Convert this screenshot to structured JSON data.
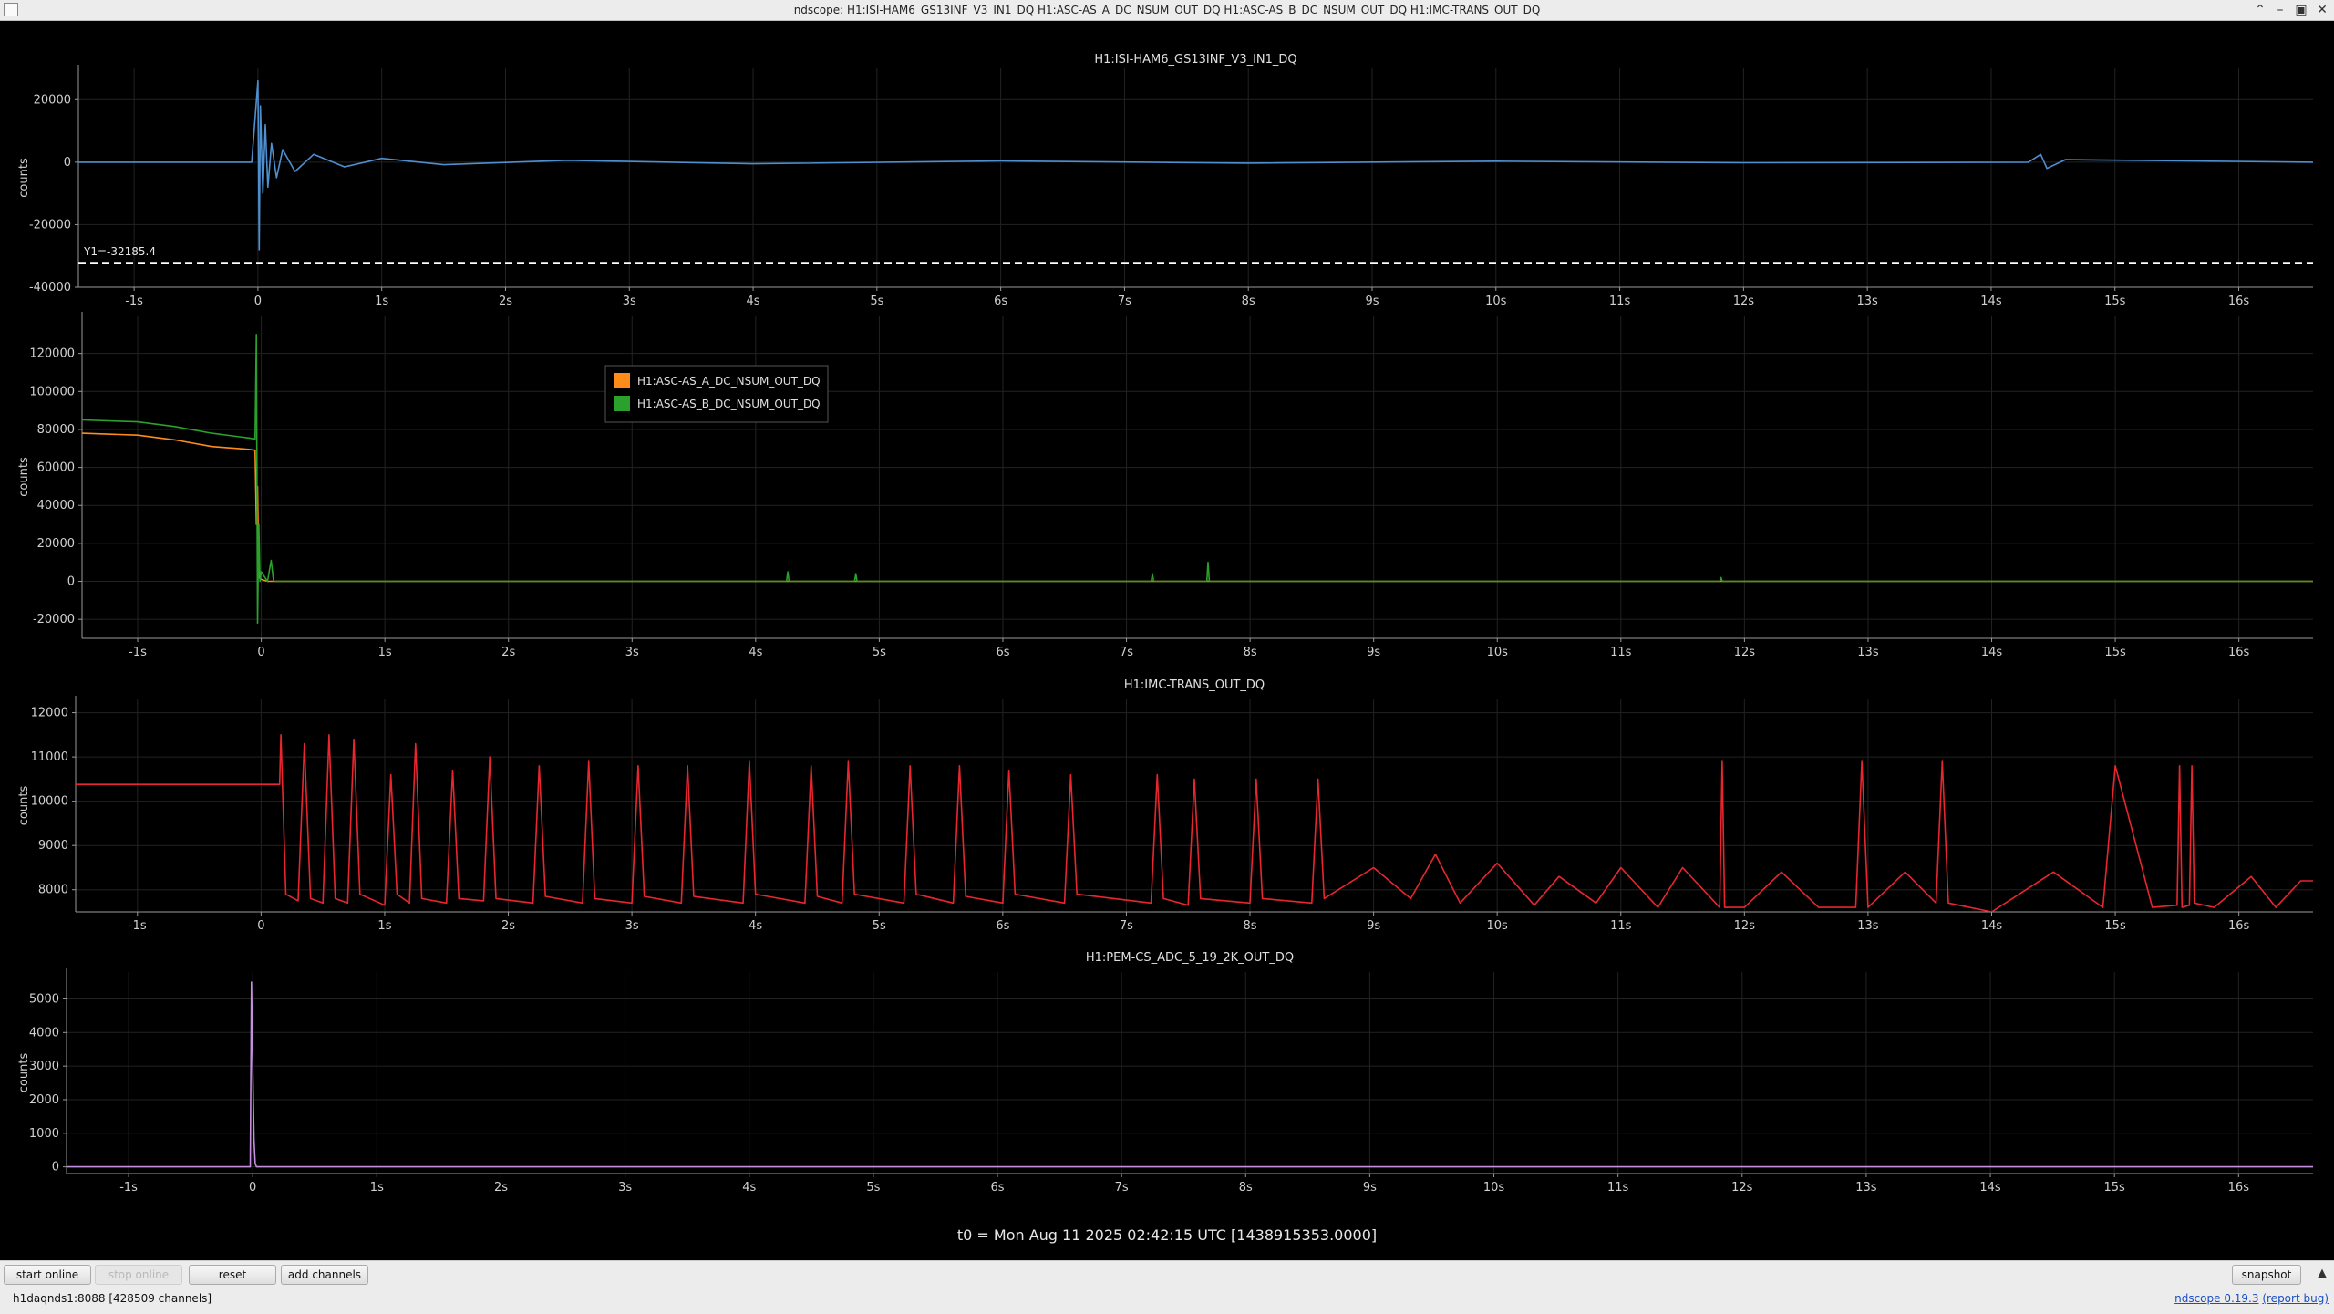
{
  "window": {
    "title": "ndscope: H1:ISI-HAM6_GS13INF_V3_IN1_DQ H1:ASC-AS_A_DC_NSUM_OUT_DQ H1:ASC-AS_B_DC_NSUM_OUT_DQ H1:IMC-TRANS_OUT_DQ"
  },
  "toolbar": {
    "start_online": "start online",
    "stop_online": "stop online",
    "reset": "reset",
    "add_channels": "add channels",
    "snapshot": "snapshot"
  },
  "status": {
    "server": "h1daqnds1:8088",
    "channels": "[428509 channels]",
    "version_link": "ndscope 0.19.3",
    "report_bug": "(report bug)"
  },
  "t0_label": "t0 = Mon Aug 11 2025 02:42:15 UTC [1438915353.0000]",
  "chart_data": [
    {
      "type": "line",
      "title": "H1:ISI-HAM6_GS13INF_V3_IN1_DQ",
      "ylabel": "counts",
      "xlim": [
        -1.45,
        16.6
      ],
      "ylim": [
        -40000,
        30000
      ],
      "x_ticks": [
        -1,
        0,
        1,
        2,
        3,
        4,
        5,
        6,
        7,
        8,
        9,
        10,
        11,
        12,
        13,
        14,
        15,
        16
      ],
      "x_tick_labels": [
        "-1s",
        "0",
        "1s",
        "2s",
        "3s",
        "4s",
        "5s",
        "6s",
        "7s",
        "8s",
        "9s",
        "10s",
        "11s",
        "12s",
        "13s",
        "14s",
        "15s",
        "16s"
      ],
      "y_ticks": [
        20000,
        0,
        -20000,
        -40000
      ],
      "y_tick_labels": [
        "20000",
        "0",
        "-20000",
        "-40000"
      ],
      "grid": true,
      "cursor": {
        "value": -32185.4,
        "label": "Y1=-32185.4"
      },
      "series": [
        {
          "color": "#4f8fd0",
          "x": [
            -1.45,
            -0.05,
            0.0,
            0.01,
            0.02,
            0.04,
            0.06,
            0.08,
            0.11,
            0.15,
            0.2,
            0.3,
            0.45,
            0.7,
            1.0,
            1.5,
            2.5,
            4.0,
            6.0,
            8.0,
            10.0,
            12.0,
            14.3,
            14.4,
            14.45,
            14.6,
            16.6
          ],
          "y": [
            0,
            0,
            26000,
            -28000,
            18000,
            -10000,
            12000,
            -8000,
            6000,
            -5000,
            4000,
            -3000,
            2500,
            -1500,
            1200,
            -800,
            600,
            -500,
            400,
            -300,
            300,
            -200,
            0,
            2500,
            -2000,
            800,
            0
          ]
        }
      ]
    },
    {
      "type": "line",
      "title": "",
      "ylabel": "counts",
      "xlim": [
        -1.45,
        16.6
      ],
      "ylim": [
        -30000,
        140000
      ],
      "x_ticks": [
        -1,
        0,
        1,
        2,
        3,
        4,
        5,
        6,
        7,
        8,
        9,
        10,
        11,
        12,
        13,
        14,
        15,
        16
      ],
      "x_tick_labels": [
        "-1s",
        "0",
        "1s",
        "2s",
        "3s",
        "4s",
        "5s",
        "6s",
        "7s",
        "8s",
        "9s",
        "10s",
        "11s",
        "12s",
        "13s",
        "14s",
        "15s",
        "16s"
      ],
      "y_ticks": [
        120000,
        100000,
        80000,
        60000,
        40000,
        20000,
        0,
        -20000
      ],
      "y_tick_labels": [
        "120000",
        "100000",
        "80000",
        "60000",
        "40000",
        "20000",
        "0",
        "-20000"
      ],
      "grid": true,
      "legend_position": "top-left",
      "series": [
        {
          "name": "H1:ASC-AS_A_DC_NSUM_OUT_DQ",
          "color": "#ff8c1a",
          "x": [
            -1.45,
            -1.0,
            -0.7,
            -0.4,
            -0.1,
            -0.05,
            -0.04,
            -0.03,
            -0.02,
            0.0,
            0.05,
            0.1,
            16.6
          ],
          "y": [
            78000,
            77000,
            74500,
            71000,
            69500,
            69000,
            30000,
            50000,
            2000,
            1000,
            0,
            0,
            0
          ]
        },
        {
          "name": "H1:ASC-AS_B_DC_NSUM_OUT_DQ",
          "color": "#2ca02c",
          "x": [
            -1.45,
            -1.0,
            -0.7,
            -0.4,
            -0.1,
            -0.05,
            -0.04,
            -0.03,
            -0.02,
            -0.01,
            0.0,
            0.05,
            0.08,
            0.1,
            0.12,
            0.14,
            4.25,
            4.26,
            4.27,
            4.8,
            4.81,
            4.82,
            7.2,
            7.21,
            7.22,
            7.65,
            7.66,
            7.67,
            11.8,
            11.81,
            11.82,
            16.6
          ],
          "y": [
            85000,
            84000,
            81500,
            78000,
            75500,
            75000,
            130000,
            -22000,
            30000,
            0,
            5000,
            0,
            11000,
            0,
            0,
            0,
            0,
            5000,
            0,
            0,
            4000,
            0,
            0,
            4000,
            0,
            0,
            10000,
            0,
            0,
            2000,
            0,
            0
          ]
        }
      ]
    },
    {
      "type": "line",
      "title": "H1:IMC-TRANS_OUT_DQ",
      "ylabel": "counts",
      "xlim": [
        -1.5,
        16.6
      ],
      "ylim": [
        7500,
        12300
      ],
      "x_ticks": [
        -1,
        0,
        1,
        2,
        3,
        4,
        5,
        6,
        7,
        8,
        9,
        10,
        11,
        12,
        13,
        14,
        15,
        16
      ],
      "x_tick_labels": [
        "-1s",
        "0",
        "1s",
        "2s",
        "3s",
        "4s",
        "5s",
        "6s",
        "7s",
        "8s",
        "9s",
        "10s",
        "11s",
        "12s",
        "13s",
        "14s",
        "15s",
        "16s"
      ],
      "y_ticks": [
        12000,
        11000,
        10000,
        9000,
        8000
      ],
      "y_tick_labels": [
        "12000",
        "11000",
        "10000",
        "9000",
        "8000"
      ],
      "grid": true,
      "series": [
        {
          "color": "#e8262f",
          "x": [
            -1.5,
            0.15,
            0.16,
            0.2,
            0.3,
            0.35,
            0.4,
            0.5,
            0.55,
            0.6,
            0.7,
            0.75,
            0.8,
            1.0,
            1.05,
            1.1,
            1.2,
            1.25,
            1.3,
            1.5,
            1.55,
            1.6,
            1.8,
            1.85,
            1.9,
            2.2,
            2.25,
            2.3,
            2.6,
            2.65,
            2.7,
            3.0,
            3.05,
            3.1,
            3.4,
            3.45,
            3.5,
            3.9,
            3.95,
            4.0,
            4.4,
            4.45,
            4.5,
            4.7,
            4.75,
            4.8,
            5.2,
            5.25,
            5.3,
            5.6,
            5.65,
            5.7,
            6.0,
            6.05,
            6.1,
            6.5,
            6.55,
            6.6,
            7.2,
            7.25,
            7.3,
            7.5,
            7.55,
            7.6,
            8.0,
            8.05,
            8.1,
            8.5,
            8.55,
            8.6,
            9.0,
            9.3,
            9.5,
            9.7,
            10.0,
            10.3,
            10.5,
            10.8,
            11.0,
            11.3,
            11.5,
            11.8,
            11.82,
            11.84,
            12.0,
            12.3,
            12.6,
            12.9,
            12.95,
            13.0,
            13.3,
            13.55,
            13.6,
            13.65,
            14.0,
            14.5,
            14.9,
            15.0,
            15.3,
            15.5,
            15.52,
            15.54,
            15.6,
            15.62,
            15.64,
            15.8,
            16.1,
            16.3,
            16.5,
            16.6
          ],
          "y": [
            10380,
            10380,
            11500,
            7900,
            7750,
            11300,
            7800,
            7700,
            11500,
            7800,
            7700,
            11400,
            7900,
            7650,
            10600,
            7900,
            7700,
            11300,
            7800,
            7700,
            10700,
            7800,
            7750,
            11000,
            7800,
            7700,
            10800,
            7850,
            7700,
            10900,
            7800,
            7700,
            10800,
            7850,
            7700,
            10800,
            7850,
            7700,
            10900,
            7900,
            7700,
            10800,
            7850,
            7700,
            10900,
            7900,
            7700,
            10800,
            7900,
            7700,
            10800,
            7850,
            7700,
            10700,
            7900,
            7700,
            10600,
            7900,
            7700,
            10600,
            7800,
            7650,
            10500,
            7800,
            7700,
            10500,
            7800,
            7700,
            10500,
            7800,
            8500,
            7800,
            8800,
            7700,
            8600,
            7650,
            8300,
            7700,
            8500,
            7600,
            8500,
            7600,
            10900,
            7600,
            7600,
            8400,
            7600,
            7600,
            10900,
            7600,
            8400,
            7700,
            10900,
            7700,
            7500,
            8400,
            7600,
            10800,
            7600,
            7650,
            10800,
            7600,
            7650,
            10800,
            7700,
            7600,
            8300,
            7600,
            8200,
            8200
          ]
        }
      ]
    },
    {
      "type": "line",
      "title": "H1:PEM-CS_ADC_5_19_2K_OUT_DQ",
      "ylabel": "counts",
      "xlim": [
        -1.5,
        16.6
      ],
      "ylim": [
        -200,
        5800
      ],
      "x_ticks": [
        -1,
        0,
        1,
        2,
        3,
        4,
        5,
        6,
        7,
        8,
        9,
        10,
        11,
        12,
        13,
        14,
        15,
        16
      ],
      "x_tick_labels": [
        "-1s",
        "0",
        "1s",
        "2s",
        "3s",
        "4s",
        "5s",
        "6s",
        "7s",
        "8s",
        "9s",
        "10s",
        "11s",
        "12s",
        "13s",
        "14s",
        "15s",
        "16s"
      ],
      "y_ticks": [
        5000,
        4000,
        3000,
        2000,
        1000,
        0
      ],
      "y_tick_labels": [
        "5000",
        "4000",
        "3000",
        "2000",
        "1000",
        "0"
      ],
      "grid": true,
      "series": [
        {
          "color": "#c58fe0",
          "x": [
            -1.5,
            -0.02,
            -0.01,
            0.0,
            0.01,
            0.02,
            0.03,
            16.6
          ],
          "y": [
            0,
            0,
            5500,
            3000,
            800,
            100,
            0,
            0
          ]
        }
      ]
    }
  ]
}
